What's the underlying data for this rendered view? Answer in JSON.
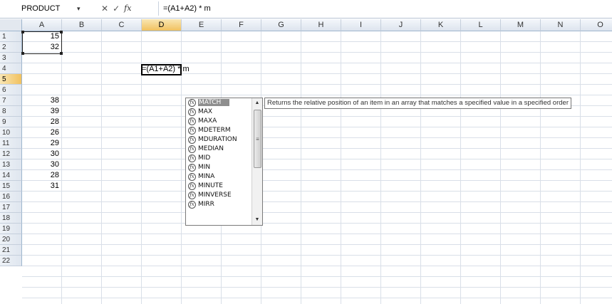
{
  "formula_bar": {
    "name_box": "PRODUCT",
    "name_box_arrow": "▾",
    "cancel_label": "✕",
    "enter_label": "✓",
    "fx_label": "fx",
    "formula": "=(A1+A2) * m"
  },
  "columns": [
    "A",
    "B",
    "C",
    "D",
    "E",
    "F",
    "G",
    "H",
    "I",
    "J",
    "K",
    "L",
    "M",
    "N",
    "O"
  ],
  "selected_column": "D",
  "rows": [
    "1",
    "2",
    "3",
    "4",
    "5",
    "6",
    "7",
    "8",
    "9",
    "10",
    "11",
    "12",
    "13",
    "14",
    "15",
    "16",
    "17",
    "18",
    "19",
    "20",
    "21",
    "22"
  ],
  "selected_row": "5",
  "column_a_values": [
    {
      "row": 1,
      "value": "15"
    },
    {
      "row": 2,
      "value": "32"
    },
    {
      "row": 7,
      "value": "38"
    },
    {
      "row": 8,
      "value": "39"
    },
    {
      "row": 9,
      "value": "28"
    },
    {
      "row": 10,
      "value": "26"
    },
    {
      "row": 11,
      "value": "29"
    },
    {
      "row": 12,
      "value": "30"
    },
    {
      "row": 13,
      "value": "30"
    },
    {
      "row": 14,
      "value": "28"
    },
    {
      "row": 15,
      "value": "31"
    }
  ],
  "active_cell": {
    "ref": "D5",
    "text": "=(A1+A2) * m"
  },
  "autocomplete": {
    "items": [
      "MATCH",
      "MAX",
      "MAXA",
      "MDETERM",
      "MDURATION",
      "MEDIAN",
      "MID",
      "MIN",
      "MINA",
      "MINUTE",
      "MINVERSE",
      "MIRR"
    ],
    "selected_index": 0,
    "icon": "function-icon",
    "scroll_up": "▲",
    "scroll_down": "▼",
    "grip": "≡"
  },
  "tooltip": "Returns the relative position of an item in an array that matches a specified value in a specified order",
  "colors": {
    "header_selected": "#f1c15f",
    "grid_line": "#d9dfe8",
    "list_selected": "#8e8e8e"
  }
}
